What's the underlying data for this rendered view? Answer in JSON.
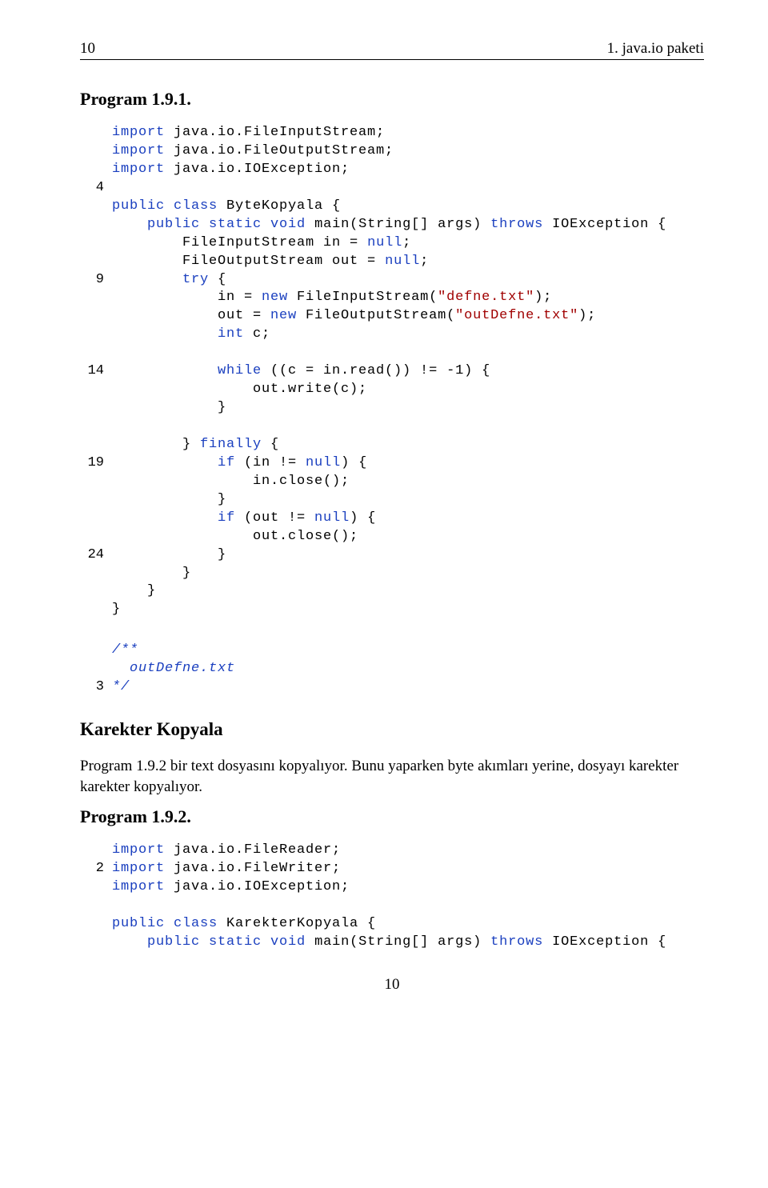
{
  "header": {
    "page_num_top": "10",
    "section": "1. java.io paketi"
  },
  "program_title_1": "Program 1.9.1.",
  "code1": {
    "l1": "import",
    "l1b": " java.io.FileInputStream;",
    "l2": "import",
    "l2b": " java.io.FileOutputStream;",
    "l3": "import",
    "l3b": " java.io.IOException;",
    "n4": "4",
    "l5a": "public",
    "l5b": " class",
    "l5c": " ByteKopyala {",
    "l6a": "    public",
    "l6b": " static",
    "l6c": " void",
    "l6d": " main(String[] args) ",
    "l6e": "throws",
    "l6f": " IOException {",
    "l7a": "        FileInputStream in = ",
    "l7b": "null",
    "l7c": ";",
    "l8a": "        FileOutputStream out = ",
    "l8b": "null",
    "l8c": ";",
    "n9": "9",
    "l9a": "        try",
    "l9b": " {",
    "l10a": "            in = ",
    "l10b": "new",
    "l10c": " FileInputStream(",
    "l10d": "\"defne.txt\"",
    "l10e": ");",
    "l11a": "            out = ",
    "l11b": "new",
    "l11c": " FileOutputStream(",
    "l11d": "\"outDefne.txt\"",
    "l11e": ");",
    "l12a": "            int",
    "l12b": " c;",
    "n14": "14",
    "l14a": "            while",
    "l14b": " ((c = in.read()) != -1) {",
    "l15": "                out.write(c);",
    "l16": "            }",
    "l18a": "        } ",
    "l18b": "finally",
    "l18c": " {",
    "n19": "19",
    "l19a": "            if",
    "l19b": " (in != ",
    "l19c": "null",
    "l19d": ") {",
    "l20": "                in.close();",
    "l21": "            }",
    "l22a": "            if",
    "l22b": " (out != ",
    "l22c": "null",
    "l22d": ") {",
    "l23": "                out.close();",
    "n24": "24",
    "l24": "            }",
    "l25": "        }",
    "l26": "    }",
    "l27": "}"
  },
  "code2": {
    "l1": "/**",
    "l2": "  outDefne.txt",
    "n3": "3",
    "l3": "*/"
  },
  "section_heading": "Karekter Kopyala",
  "para": "Program 1.9.2 bir text dosyasını kopyalıyor. Bunu yaparken byte akımları yerine, dosyayı karekter karekter kopyalıyor.",
  "program_title_2": "Program 1.9.2.",
  "code3": {
    "l1a": "import",
    "l1b": " java.io.FileReader;",
    "n2": "2",
    "l2a": "import",
    "l2b": " java.io.FileWriter;",
    "l3a": "import",
    "l3b": " java.io.IOException;",
    "l5a": "public",
    "l5b": " class",
    "l5c": " KarekterKopyala {",
    "l6a": "    public",
    "l6b": " static",
    "l6c": " void",
    "l6d": " main(String[] args) ",
    "l6e": "throws",
    "l6f": " IOException {"
  },
  "footer_page": "10"
}
